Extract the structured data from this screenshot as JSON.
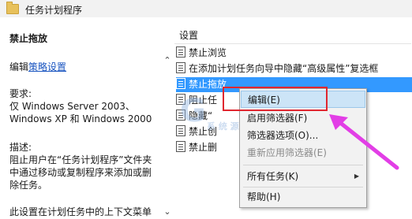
{
  "window": {
    "title": "任务计划程序",
    "icon": "folder-icon"
  },
  "left_panel": {
    "heading": "禁止拖放",
    "edit_prefix": "编辑",
    "edit_link": "策略设置",
    "requirements_label": "要求:",
    "requirements_line1": "仅 Windows Server 2003、",
    "requirements_line2": "Windows XP 和 Windows 2000",
    "description_label": "描述:",
    "description_line1": "阻止用户在“任务计划程序”文件夹",
    "description_line2": "中通过移动或复制程序来添加或删",
    "description_line3": "除任务。",
    "description_line4": "此设置在计划任务中的上下文菜单"
  },
  "settings_list": {
    "header": "设置",
    "rows": [
      {
        "label": "禁止浏览",
        "selected": false
      },
      {
        "label": "在添加计划任务向导中隐藏“高级属性”复选框",
        "selected": false
      },
      {
        "label": "禁止拖放",
        "selected": true
      },
      {
        "label": "阻止任",
        "selected": false
      },
      {
        "label": "隐藏“",
        "selected": false
      },
      {
        "label": "禁止创",
        "selected": false
      },
      {
        "label": "禁止删",
        "selected": false
      }
    ]
  },
  "context_menu": {
    "items": [
      {
        "label": "编辑(E)",
        "highlighted": true,
        "disabled": false
      },
      {
        "label": "启用筛选器(F)",
        "highlighted": false,
        "disabled": false
      },
      {
        "label": "筛选器选项(O)...",
        "highlighted": false,
        "disabled": false
      },
      {
        "label": "重新应用筛选器(E)",
        "highlighted": false,
        "disabled": true
      },
      {
        "label": "所有任务(K)",
        "highlighted": false,
        "disabled": false,
        "submenu": true
      },
      {
        "label": "帮助(H)",
        "highlighted": false,
        "disabled": false
      }
    ]
  },
  "watermark": {
    "text": "G",
    "subtext": "系 统 源 码"
  },
  "colors": {
    "selection": "#3399ff",
    "menu_highlight": "#cce4f7",
    "annotation_red": "#e0262f",
    "annotation_arrow": "#e23ee6",
    "link": "#1a55c0"
  }
}
